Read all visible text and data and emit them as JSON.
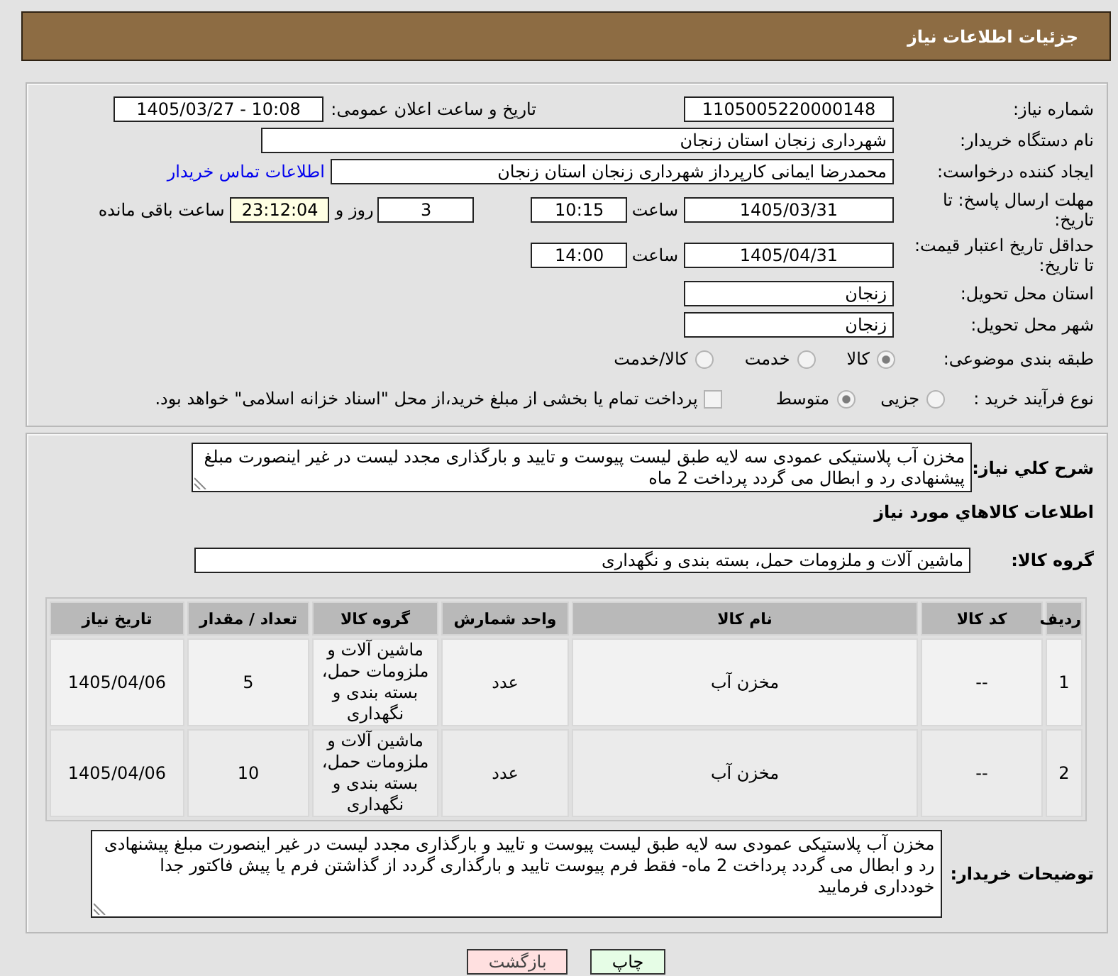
{
  "header": {
    "title": "جزئیات اطلاعات نیاز"
  },
  "details": {
    "need_number": {
      "label": "شماره نیاز:",
      "value": "1105005220000148"
    },
    "announce": {
      "label": "تاریخ و ساعت اعلان عمومی:",
      "value": "1405/03/27 - 10:08"
    },
    "buyer_org": {
      "label": "نام دستگاه خریدار:",
      "value": "شهرداری زنجان استان زنجان"
    },
    "requester": {
      "label": "ایجاد کننده درخواست:",
      "value": "محمدرضا ایمانی کارپرداز شهرداری زنجان استان زنجان",
      "link": "اطلاعات تماس خریدار"
    },
    "response_deadline": {
      "label": "مهلت ارسال پاسخ: تا تاریخ:",
      "date": "1405/03/31",
      "time_label": "ساعت",
      "time": "10:15",
      "days": "3",
      "days_label": "روز و",
      "remaining": "23:12:04",
      "remaining_label": "ساعت باقی مانده"
    },
    "price_validity": {
      "label": "حداقل تاریخ اعتبار قیمت: تا تاریخ:",
      "date": "1405/04/31",
      "time_label": "ساعت",
      "time": "14:00"
    },
    "province": {
      "label": "استان محل تحویل:",
      "value": "زنجان"
    },
    "city": {
      "label": "شهر محل تحویل:",
      "value": "زنجان"
    },
    "category": {
      "label": "طبقه بندی موضوعی:",
      "options": [
        {
          "label": "کالا",
          "selected": true
        },
        {
          "label": "خدمت",
          "selected": false
        },
        {
          "label": "کالا/خدمت",
          "selected": false
        }
      ]
    },
    "process": {
      "label": "نوع فرآیند خرید :",
      "options": [
        {
          "label": "جزیی",
          "selected": false
        },
        {
          "label": "متوسط",
          "selected": true
        }
      ],
      "treasury": {
        "label": "پرداخت تمام یا بخشی از مبلغ خرید،از محل \"اسناد خزانه اسلامی\" خواهد بود.",
        "checked": false
      }
    }
  },
  "need": {
    "description": {
      "label": "شرح کلي نیاز:",
      "value": "مخزن آب پلاستیکی عمودی سه لایه طبق لیست پیوست و تایید و بارگذاری مجدد لیست در غیر اینصورت مبلغ پیشنهادی رد و ابطال می گردد پرداخت 2 ماه"
    },
    "goods_title": "اطلاعات کالاهاي مورد نیاز",
    "goods_group": {
      "label": "گروه کالا:",
      "value": "ماشین آلات و ملزومات حمل، بسته بندی و نگهداری"
    },
    "table": {
      "columns": [
        "ردیف",
        "کد کالا",
        "نام کالا",
        "واحد شمارش",
        "گروه کالا",
        "تعداد / مقدار",
        "تاریخ نیاز"
      ],
      "rows": [
        [
          "1",
          "--",
          "مخزن آب",
          "عدد",
          "ماشین آلات و ملزومات حمل، بسته بندی و نگهداری",
          "5",
          "1405/04/06"
        ],
        [
          "2",
          "--",
          "مخزن آب",
          "عدد",
          "ماشین آلات و ملزومات حمل، بسته بندی و نگهداری",
          "10",
          "1405/04/06"
        ]
      ]
    },
    "buyer_notes": {
      "label": "توضیحات خریدار:",
      "value": "مخزن آب پلاستیکی عمودی سه لایه طبق لیست پیوست و تایید و بارگذاری مجدد لیست در غیر اینصورت مبلغ پیشنهادی رد و ابطال می گردد پرداخت 2 ماه- فقط فرم پیوست تایید و بارگذاری گردد از گذاشتن فرم یا پیش فاکتور جدا خودداری فرمایید"
    }
  },
  "buttons": [
    {
      "label": "چاپ",
      "kind": "print"
    },
    {
      "label": "بازگشت",
      "kind": "back"
    }
  ]
}
